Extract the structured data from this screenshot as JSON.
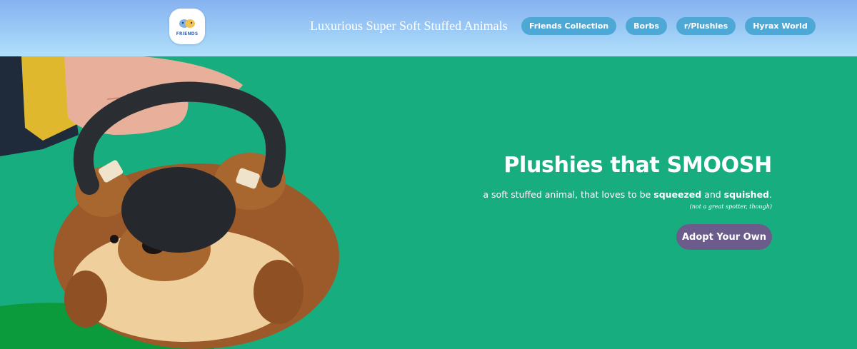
{
  "header": {
    "logo_text": "FRIENDS",
    "site_title": "Luxurious Super Soft Stuffed Animals",
    "nav": [
      {
        "label": "Friends Collection"
      },
      {
        "label": "Borbs"
      },
      {
        "label": "r/Plushies"
      },
      {
        "label": "Hyrax World"
      }
    ]
  },
  "hero": {
    "headline": "Plushies that SMOOSH",
    "subline_pre": "a soft stuffed animal, that loves to be ",
    "subline_bold1": "squeezed",
    "subline_mid": " and ",
    "subline_bold2": "squished",
    "subline_post": ".",
    "note": "(not a great spotter, though)",
    "cta_label": "Adopt Your Own",
    "image_icon": "plush-kettlebell-photo"
  },
  "colors": {
    "hero_bg": "#18ad7f",
    "nav_pill": "#4ea8d6",
    "cta": "#6b5c8c",
    "header_top": "#86b2f0",
    "header_bottom": "#b1e0fa"
  }
}
